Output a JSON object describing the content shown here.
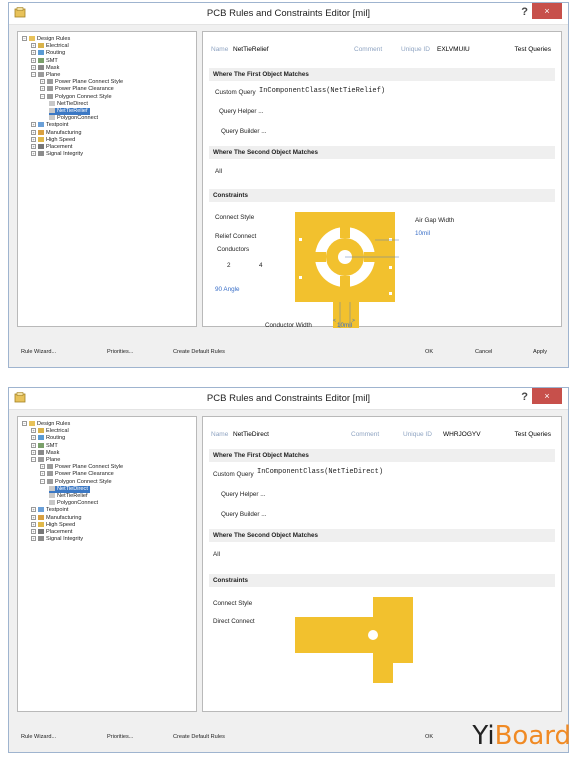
{
  "windows": [
    {
      "title": "PCB Rules and Constraints Editor [mil]",
      "help": "?",
      "close": "×",
      "tree": [
        {
          "label": "Design Rules",
          "indent": 0,
          "exp": "−",
          "icon": "folder"
        },
        {
          "label": "Electrical",
          "indent": 1,
          "exp": "+",
          "icon": "electrical"
        },
        {
          "label": "Routing",
          "indent": 1,
          "exp": "+",
          "icon": "routing"
        },
        {
          "label": "SMT",
          "indent": 1,
          "exp": "+",
          "icon": "smt"
        },
        {
          "label": "Mask",
          "indent": 1,
          "exp": "+",
          "icon": "mask"
        },
        {
          "label": "Plane",
          "indent": 1,
          "exp": "−",
          "icon": "plane"
        },
        {
          "label": "Power Plane Connect Style",
          "indent": 2,
          "exp": "+",
          "icon": "plane"
        },
        {
          "label": "Power Plane Clearance",
          "indent": 2,
          "exp": "+",
          "icon": "plane"
        },
        {
          "label": "Polygon Connect Style",
          "indent": 2,
          "exp": "−",
          "icon": "plane"
        },
        {
          "label": "NetTieDirect",
          "indent": 3,
          "exp": "",
          "icon": "rule"
        },
        {
          "label": "NetTieRelief",
          "indent": 3,
          "exp": "",
          "icon": "rule",
          "selected": true
        },
        {
          "label": "PolygonConnect",
          "indent": 3,
          "exp": "",
          "icon": "rule"
        },
        {
          "label": "Testpoint",
          "indent": 1,
          "exp": "+",
          "icon": "testpoint"
        },
        {
          "label": "Manufacturing",
          "indent": 1,
          "exp": "+",
          "icon": "manufacturing"
        },
        {
          "label": "High Speed",
          "indent": 1,
          "exp": "+",
          "icon": "highspeed"
        },
        {
          "label": "Placement",
          "indent": 1,
          "exp": "+",
          "icon": "placement"
        },
        {
          "label": "Signal Integrity",
          "indent": 1,
          "exp": "+",
          "icon": "signal"
        }
      ],
      "name_label": "Name",
      "name_value": "NetTieRelief",
      "comment_label": "Comment",
      "unique_id_label": "Unique ID",
      "unique_id_value": "EXLVMUIU",
      "test_queries": "Test Queries",
      "first_match_header": "Where The First Object Matches",
      "custom_query": "Custom Query",
      "query_text": "InComponentClass(NetTieRelief)",
      "query_helper": "Query Helper ...",
      "query_builder": "Query Builder ...",
      "second_match_header": "Where The Second Object Matches",
      "second_match_value": "All",
      "constraints_header": "Constraints",
      "connect_style_label": "Connect Style",
      "connect_style_value": "Relief Connect",
      "conductors_label": "Conductors",
      "conductors_2": "2",
      "conductors_4": "4",
      "angle_label": "90 Angle",
      "air_gap_label": "Air Gap Width",
      "air_gap_value": "10mil",
      "conductor_width_label": "Conductor Width",
      "conductor_width_value": "10mil",
      "buttons": {
        "wizard": "Rule Wizard...",
        "priorities": "Priorities...",
        "create_default": "Create Default Rules",
        "ok": "OK",
        "cancel": "Cancel",
        "apply": "Apply"
      }
    },
    {
      "title": "PCB Rules and Constraints Editor [mil]",
      "help": "?",
      "close": "×",
      "tree": [
        {
          "label": "Design Rules",
          "indent": 0,
          "exp": "−",
          "icon": "folder"
        },
        {
          "label": "Electrical",
          "indent": 1,
          "exp": "+",
          "icon": "electrical"
        },
        {
          "label": "Routing",
          "indent": 1,
          "exp": "+",
          "icon": "routing"
        },
        {
          "label": "SMT",
          "indent": 1,
          "exp": "+",
          "icon": "smt"
        },
        {
          "label": "Mask",
          "indent": 1,
          "exp": "+",
          "icon": "mask"
        },
        {
          "label": "Plane",
          "indent": 1,
          "exp": "−",
          "icon": "plane"
        },
        {
          "label": "Power Plane Connect Style",
          "indent": 2,
          "exp": "+",
          "icon": "plane"
        },
        {
          "label": "Power Plane Clearance",
          "indent": 2,
          "exp": "+",
          "icon": "plane"
        },
        {
          "label": "Polygon Connect Style",
          "indent": 2,
          "exp": "−",
          "icon": "plane"
        },
        {
          "label": "NetTieDirect",
          "indent": 3,
          "exp": "",
          "icon": "rule",
          "selected": true
        },
        {
          "label": "NetTieRelief",
          "indent": 3,
          "exp": "",
          "icon": "rule"
        },
        {
          "label": "PolygonConnect",
          "indent": 3,
          "exp": "",
          "icon": "rule"
        },
        {
          "label": "Testpoint",
          "indent": 1,
          "exp": "+",
          "icon": "testpoint"
        },
        {
          "label": "Manufacturing",
          "indent": 1,
          "exp": "+",
          "icon": "manufacturing"
        },
        {
          "label": "High Speed",
          "indent": 1,
          "exp": "+",
          "icon": "highspeed"
        },
        {
          "label": "Placement",
          "indent": 1,
          "exp": "+",
          "icon": "placement"
        },
        {
          "label": "Signal Integrity",
          "indent": 1,
          "exp": "+",
          "icon": "signal"
        }
      ],
      "name_label": "Name",
      "name_value": "NetTieDirect",
      "comment_label": "Comment",
      "unique_id_label": "Unique ID",
      "unique_id_value": "WHRJOGYV",
      "test_queries": "Test Queries",
      "first_match_header": "Where The First Object Matches",
      "custom_query": "Custom Query",
      "query_text": "InComponentClass(NetTieDirect)",
      "query_helper": "Query Helper ...",
      "query_builder": "Query Builder ...",
      "second_match_header": "Where The Second Object Matches",
      "second_match_value": "All",
      "constraints_header": "Constraints",
      "connect_style_label": "Connect Style",
      "connect_style_value": "Direct Connect",
      "buttons": {
        "wizard": "Rule Wizard...",
        "priorities": "Priorities...",
        "create_default": "Create Default Rules",
        "ok": "OK"
      }
    }
  ],
  "watermark": {
    "part1": "Yi",
    "part2": "Board"
  },
  "colors": {
    "selection": "#3b78c4",
    "pad": "#f2c12e",
    "link": "#3a6fc8",
    "watermark_accent": "#f08a24"
  }
}
